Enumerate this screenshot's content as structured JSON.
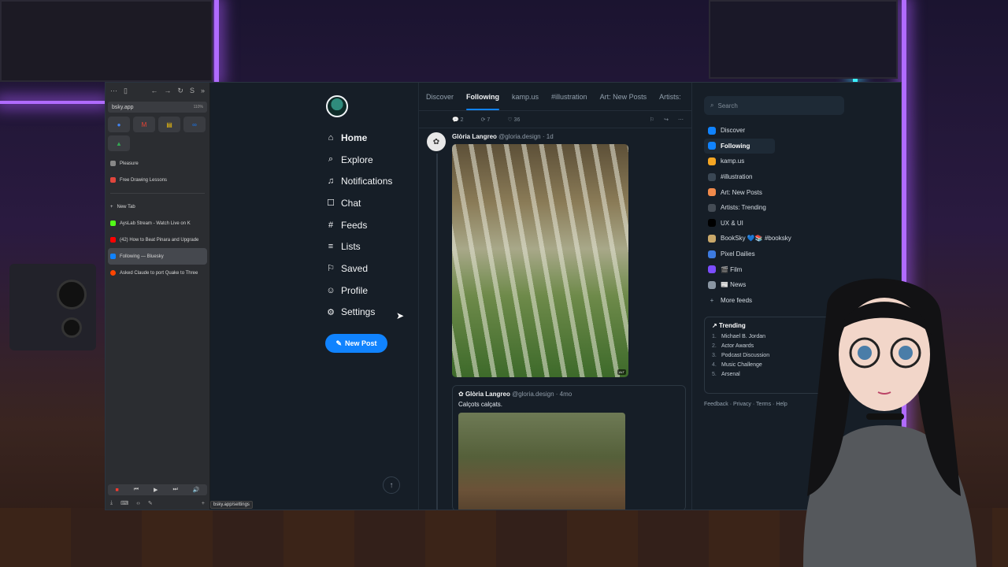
{
  "browser": {
    "url": "bsky.app",
    "zoom": "110%",
    "tabs": [
      {
        "label": "Pleasure",
        "color": "#888888"
      },
      {
        "label": "Free Drawing Lessons",
        "color": "#e0463d"
      }
    ],
    "new_tab": "New Tab",
    "open_tabs": [
      {
        "label": "AysLab Stream - Watch Live on K",
        "color": "#53fc18",
        "active": false
      },
      {
        "label": "(42) How to Beat Pinara and Upgrade",
        "color": "#ff0000",
        "active": false
      },
      {
        "label": "Following — Bluesky",
        "color": "#1083fe",
        "active": true
      },
      {
        "label": "Asked Claude to port Quake to Three",
        "color": "#ff4500",
        "active": false
      }
    ],
    "status_url": "bsky.app/settings"
  },
  "nav": {
    "items": [
      {
        "label": "Home",
        "icon": "⌂",
        "name": "home",
        "active": true
      },
      {
        "label": "Explore",
        "icon": "⌕",
        "name": "explore"
      },
      {
        "label": "Notifications",
        "icon": "♫",
        "name": "notifications"
      },
      {
        "label": "Chat",
        "icon": "☐",
        "name": "chat"
      },
      {
        "label": "Feeds",
        "icon": "#",
        "name": "feeds"
      },
      {
        "label": "Lists",
        "icon": "≡",
        "name": "lists"
      },
      {
        "label": "Saved",
        "icon": "⚐",
        "name": "saved"
      },
      {
        "label": "Profile",
        "icon": "☺",
        "name": "profile"
      },
      {
        "label": "Settings",
        "icon": "⚙",
        "name": "settings"
      }
    ],
    "new_post": "New Post"
  },
  "feed_tabs": [
    "Discover",
    "Following",
    "kamp.us",
    "#illustration",
    "Art: New Posts",
    "Artists:"
  ],
  "actions": {
    "replies": "2",
    "reposts": "7",
    "likes": "36"
  },
  "post": {
    "author": "Glòria Langreo",
    "handle": "@gloria.design",
    "time": "· 1d",
    "alt": "ALT"
  },
  "quote": {
    "author": "Glòria Langreo",
    "handle": "@gloria.design",
    "time": "· 4mo",
    "text": "Calçots calçats."
  },
  "search": {
    "placeholder": "Search"
  },
  "feeds": [
    {
      "label": "Discover",
      "color": "#1083fe",
      "active": false
    },
    {
      "label": "Following",
      "color": "#1083fe",
      "active": true
    },
    {
      "label": "kamp.us",
      "color": "#f5a623",
      "active": false
    },
    {
      "label": "#illustration",
      "color": "#3a4754",
      "active": false
    },
    {
      "label": "Art: New Posts",
      "color": "#f08a4b",
      "active": false
    },
    {
      "label": "Artists: Trending",
      "color": "#444c55",
      "active": false
    },
    {
      "label": "UX & UI",
      "color": "#000000",
      "active": false
    },
    {
      "label": "BookSky 💙📚 #booksky",
      "color": "#c9a86a",
      "active": false
    },
    {
      "label": "Pixel Dailies",
      "color": "#3d7be0",
      "active": false
    },
    {
      "label": "🎬 Film",
      "color": "#7c4dff",
      "active": false
    },
    {
      "label": "📰 News",
      "color": "#8a96a3",
      "active": false
    },
    {
      "label": "More feeds",
      "color": "",
      "active": false
    }
  ],
  "trending": {
    "title": "Trending",
    "items": [
      "Michael B. Jordan",
      "Actor Awards",
      "Podcast Discussion",
      "Music Challenge",
      "Arsenal"
    ]
  },
  "footer": [
    "Feedback",
    "Privacy",
    "Terms",
    "Help"
  ]
}
